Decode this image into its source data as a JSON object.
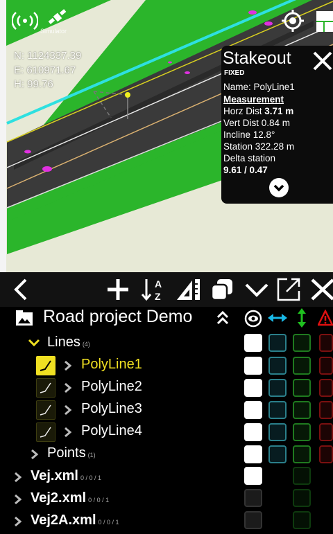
{
  "map": {
    "coords": {
      "n": "N: 1124337.39",
      "e": "E: 610971.67",
      "h": "H: 99.76"
    },
    "simulator_label": "Simulator"
  },
  "stakeout": {
    "title": "Stakeout",
    "status": "FIXED",
    "name_line": "Name: PolyLine1",
    "measurement_label": "Measurement",
    "horz_label": "Horz Dist ",
    "horz_value": "3.71 m",
    "vert_line": "Vert Dist 0.84 m",
    "incline_line": "Incline 12.8°",
    "station_line": "Station 322.28 m",
    "delta_label": "Delta station",
    "delta_value": "9.61 / 0.47"
  },
  "toolbar": {
    "icons": [
      "back-icon",
      "add-icon",
      "sort-az-icon",
      "measure-tool-icon",
      "copy-icon",
      "collapse-icon",
      "open-external-icon",
      "close-icon"
    ]
  },
  "layers": {
    "project_title": "Road project Demo",
    "groups": {
      "lines": {
        "label": "Lines",
        "count": "(4)"
      },
      "points": {
        "label": "Points",
        "count": "(1)"
      }
    },
    "polylines": [
      {
        "label": "PolyLine1"
      },
      {
        "label": "PolyLine2"
      },
      {
        "label": "PolyLine3"
      },
      {
        "label": "PolyLine4"
      }
    ],
    "files": [
      {
        "label": "Vej.xml",
        "counts": "0 / 0 / 1"
      },
      {
        "label": "Vej2.xml",
        "counts": "0 / 0 / 1"
      },
      {
        "label": "Vej2A.xml",
        "counts": "0 / 0 / 1"
      }
    ],
    "colors": {
      "highlight": "#f0e022",
      "cyan": "#19b8e6",
      "green": "#1fc01f",
      "red": "#e01010"
    }
  }
}
